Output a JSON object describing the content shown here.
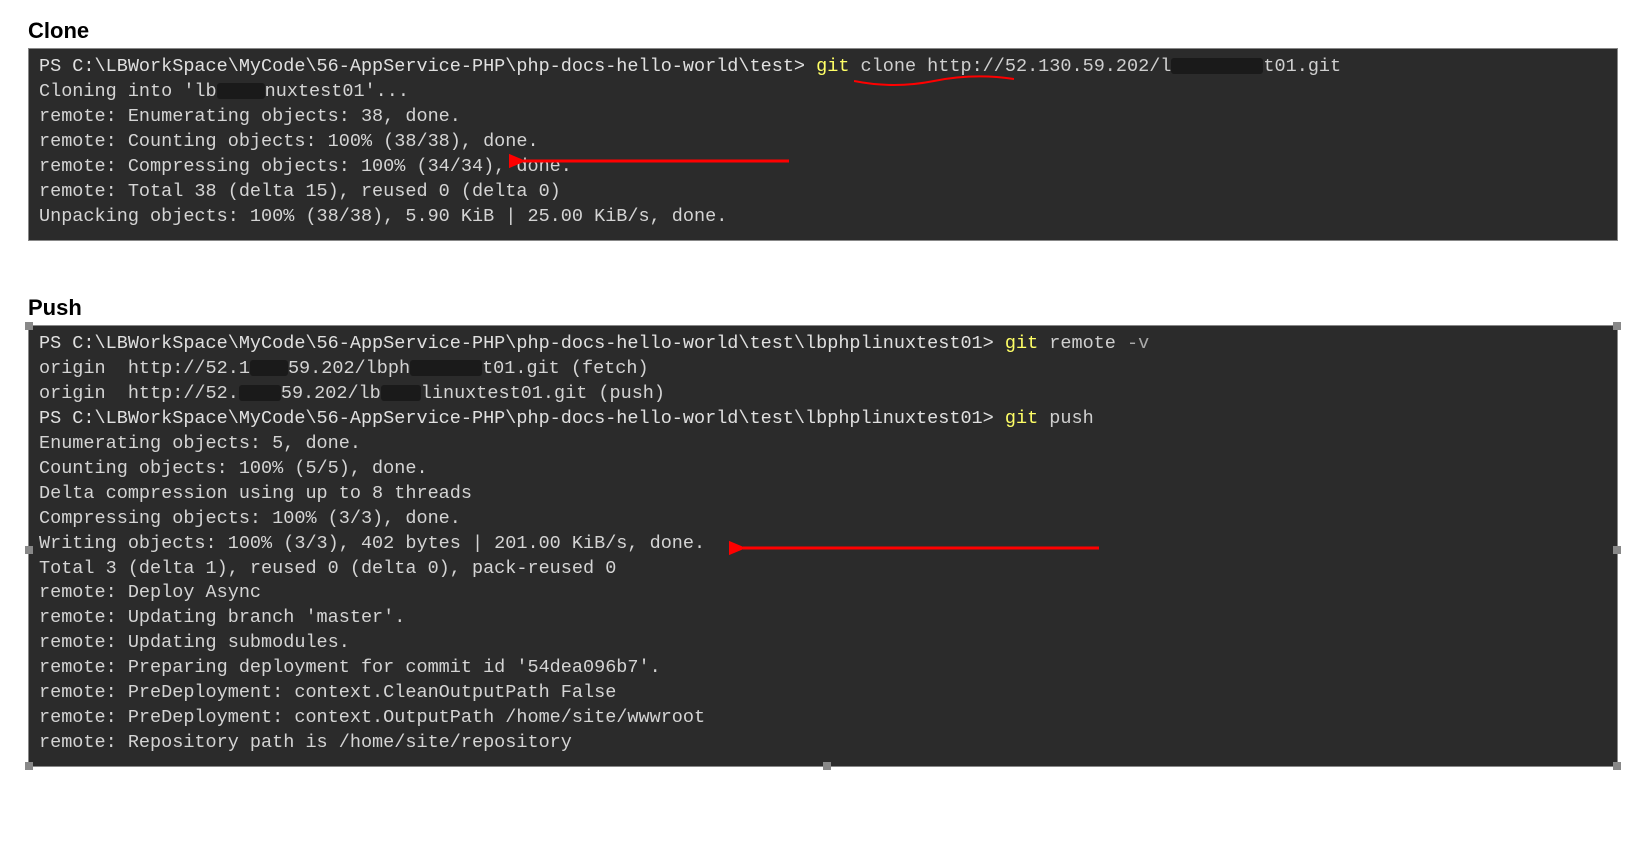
{
  "sections": {
    "clone": {
      "title": "Clone",
      "prompt1_path": "PS C:\\LBWorkSpace\\MyCode\\56-AppService-PHP\\php-docs-hello-world\\test> ",
      "cmd1_git": "git",
      "cmd1_rest": " clone http://52.130.59.202/l",
      "cmd1_tail": "t01.git",
      "out1": "Cloning into 'lb",
      "out1b": "nuxtest01'...",
      "out2": "remote: Enumerating objects: 38, done.",
      "out3": "remote: Counting objects: 100% (38/38), done.",
      "out4": "remote: Compressing objects: 100% (34/34), done.",
      "out5": "remote: Total 38 (delta 15), reused 0 (delta 0)",
      "out6": "Unpacking objects: 100% (38/38), 5.90 KiB | 25.00 KiB/s, done."
    },
    "push": {
      "title": "Push",
      "prompt1_path": "PS C:\\LBWorkSpace\\MyCode\\56-AppService-PHP\\php-docs-hello-world\\test\\lbphplinuxtest01> ",
      "cmd1_git": "git",
      "cmd1_rest": " remote ",
      "cmd1_flag": "-v",
      "origin_fetch_a": "origin  http://52.1",
      "origin_fetch_b": "59.202/lbph",
      "origin_fetch_c": "t01.git (fetch)",
      "origin_push_a": "origin  http://52.",
      "origin_push_b": "59.202/lb",
      "origin_push_c": "linuxtest01.git (push)",
      "prompt2_path": "PS C:\\LBWorkSpace\\MyCode\\56-AppService-PHP\\php-docs-hello-world\\test\\lbphplinuxtest01> ",
      "cmd2_git": "git",
      "cmd2_rest": " push",
      "out1": "Enumerating objects: 5, done.",
      "out2": "Counting objects: 100% (5/5), done.",
      "out3": "Delta compression using up to 8 threads",
      "out4": "Compressing objects: 100% (3/3), done.",
      "out5": "Writing objects: 100% (3/3), 402 bytes | 201.00 KiB/s, done.",
      "out6": "Total 3 (delta 1), reused 0 (delta 0), pack-reused 0",
      "out7": "remote: Deploy Async",
      "out8": "remote: Updating branch 'master'.",
      "out9": "remote: Updating submodules.",
      "out10": "remote: Preparing deployment for commit id '54dea096b7'.",
      "out11": "remote: PreDeployment: context.CleanOutputPath False",
      "out12": "remote: PreDeployment: context.OutputPath /home/site/wwwroot",
      "out13": "remote: Repository path is /home/site/repository"
    }
  },
  "annotations": {
    "clone_arrow": "red-arrow",
    "push_arrow": "red-arrow",
    "clone_underline": "red-underline"
  }
}
